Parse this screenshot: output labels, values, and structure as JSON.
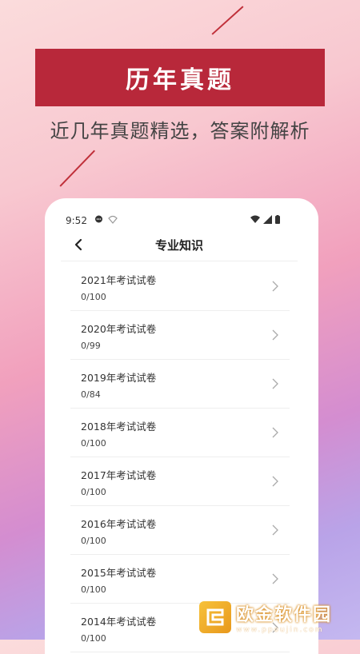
{
  "promo": {
    "banner_title": "历年真题",
    "subtitle": "近几年真题精选，答案附解析",
    "accent_color": "#b8283a"
  },
  "status_bar": {
    "time": "9:52"
  },
  "header": {
    "title": "专业知识",
    "back_icon": "chevron-left-icon"
  },
  "exams": [
    {
      "name": "2021年考试试卷",
      "progress": "0/100"
    },
    {
      "name": "2020年考试试卷",
      "progress": "0/99"
    },
    {
      "name": "2019年考试试卷",
      "progress": "0/84"
    },
    {
      "name": "2018年考试试卷",
      "progress": "0/100"
    },
    {
      "name": "2017年考试试卷",
      "progress": "0/100"
    },
    {
      "name": "2016年考试试卷",
      "progress": "0/100"
    },
    {
      "name": "2015年考试试卷",
      "progress": "0/100"
    },
    {
      "name": "2014年考试试卷",
      "progress": "0/100"
    }
  ],
  "watermark": {
    "name": "欧金软件园",
    "url": "www.ppoujin.com"
  }
}
